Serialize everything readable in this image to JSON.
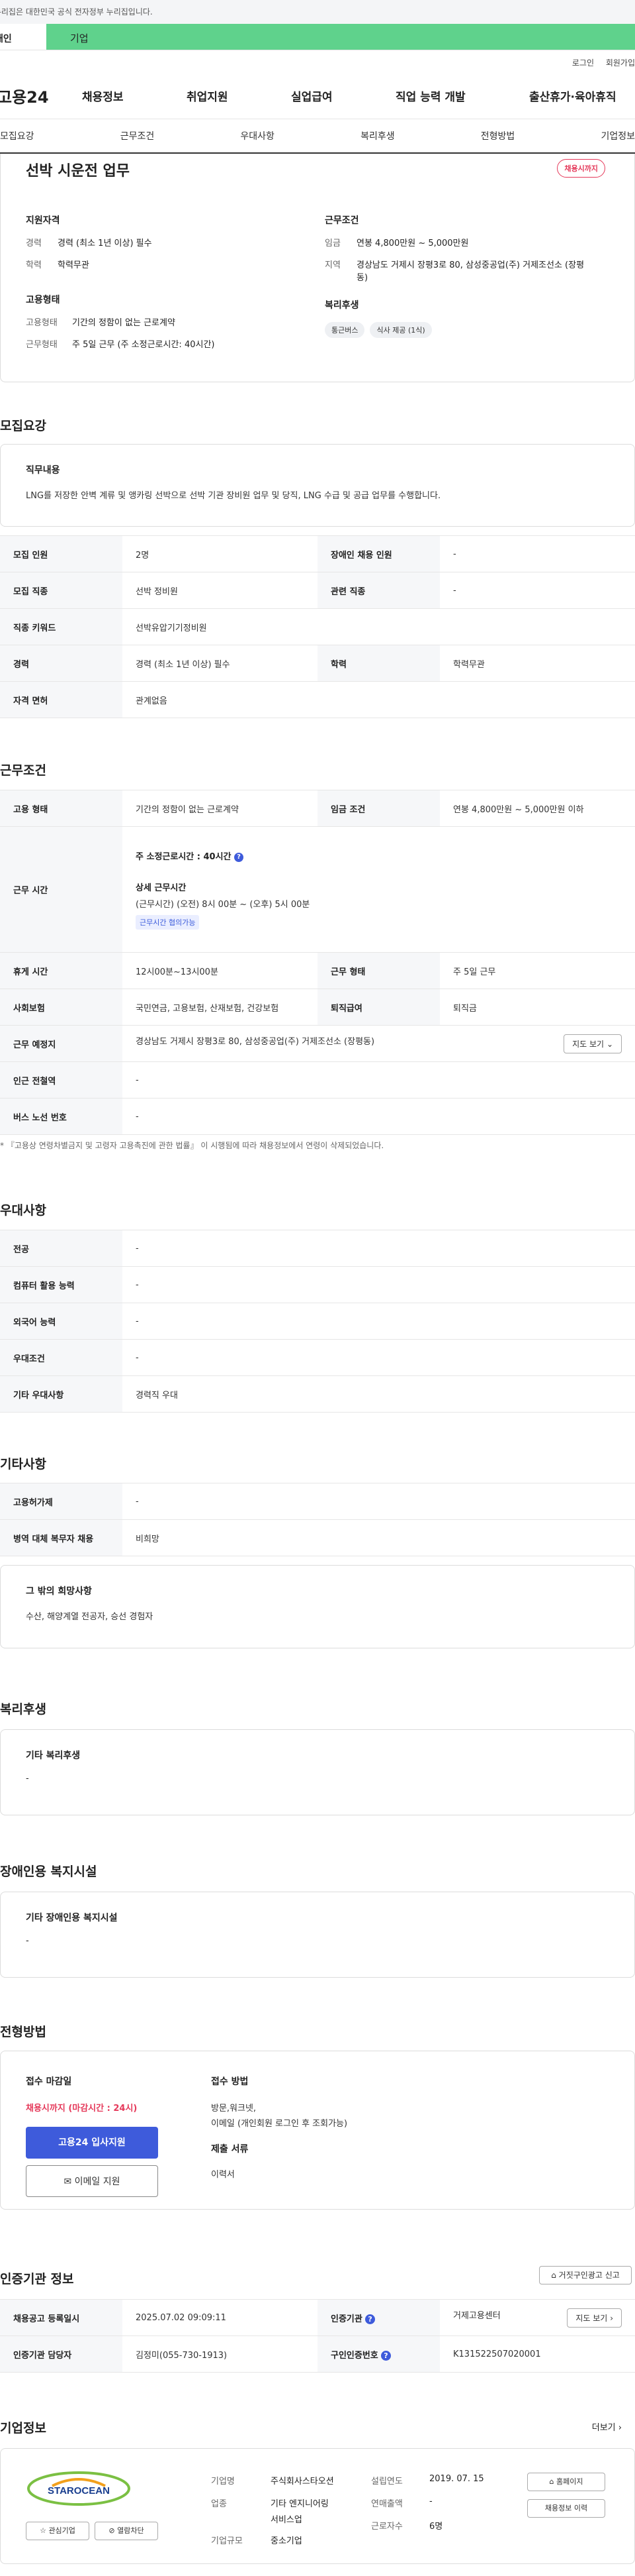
{
  "gov_banner": "이 누리집은 대한민국 공식 전자정부 누리집입니다.",
  "tabs": {
    "personal": "개인",
    "business": "기업"
  },
  "util": {
    "login": "로그인",
    "signup": "회원가입"
  },
  "gnb": {
    "logo": "고용24",
    "menus": [
      "채용정보",
      "취업지원",
      "실업급여",
      "직업 능력 개발",
      "출산휴가·육아휴직"
    ]
  },
  "subnav": [
    "모집요강",
    "근무조건",
    "우대사항",
    "복리후생",
    "전형방법",
    "기업정보"
  ],
  "summary": {
    "title": "선박 시운전 업무",
    "badge": "채용시까지",
    "qual_title": "지원자격",
    "career_k": "경력",
    "career_v": "경력 (최소 1년 이상) 필수",
    "edu_k": "학력",
    "edu_v": "학력무관",
    "emp_title": "고용형태",
    "emptype_k": "고용형태",
    "emptype_v": "기간의 정함이 없는 근로계약",
    "worktype_k": "근무형태",
    "worktype_v": "주 5일 근무 (주 소정근로시간: 40시간)",
    "cond_title": "근무조건",
    "wage_k": "임금",
    "wage_v": "연봉 4,800만원 ~ 5,000만원",
    "loc_k": "지역",
    "loc_v": "경상남도 거제시 장평3로 80, 삼성중공업(주) 거제조선소 (장평동)",
    "welfare_title": "복리후생",
    "chips": [
      "통근버스",
      "식사 제공 (1식)"
    ]
  },
  "recruit": {
    "title": "모집요강",
    "duty_title": "직무내용",
    "duty_text": "LNG를 저장한 안벽 계류 및 앵카링 선박으로 선박 기관 장비원 업무 및 당직, LNG 수급 및 공급 업무를 수행합니다.",
    "rows": [
      {
        "k1": "모집 인원",
        "v1": "2명",
        "k2": "장애인 채용 인원",
        "v2": "-"
      },
      {
        "k1": "모집 직종",
        "v1": "선박 정비원",
        "k2": "관련 직종",
        "v2": "-"
      },
      {
        "k1": "직종 키워드",
        "v1": "선박유압기기정비원"
      },
      {
        "k1": "경력",
        "v1": "경력 (최소 1년 이상) 필수",
        "k2": "학력",
        "v2": "학력무관"
      },
      {
        "k1": "자격 면허",
        "v1": "관계없음"
      }
    ]
  },
  "work": {
    "title": "근무조건",
    "emptype_k": "고용 형태",
    "emptype_v": "기간의 정함이 없는 근로계약",
    "wage_k": "임금 조건",
    "wage_v": "연봉 4,800만원 ~ 5,000만원 이하",
    "hours_k": "근무 시간",
    "hours_main": "주 소정근로시간 : 40시간",
    "hours_detail_title": "상세 근무시간",
    "hours_detail": "(근무시간) (오전) 8시 00분 ~ (오후) 5시 00분",
    "hours_badge": "근무시간 협의가능",
    "rest_k": "휴게 시간",
    "rest_v": "12시00분~13시00분",
    "form_k": "근무 형태",
    "form_v": "주 5일 근무",
    "ins_k": "사회보험",
    "ins_v": "국민연금, 고용보험, 산재보험, 건강보험",
    "ret_k": "퇴직급여",
    "ret_v": "퇴직금",
    "place_k": "근무 예정지",
    "place_v": "경상남도 거제시 장평3로 80, 삼성중공업(주) 거제조선소 (장평동)",
    "map_btn": "지도 보기",
    "sub_k": "인근 전철역",
    "sub_v": "-",
    "bus_k": "버스 노선 번호",
    "bus_v": "-",
    "note": "* 『고용상 연령차별금지 및 고령자 고용촉진에 관한 법률』 이 시행됨에 따라 채용정보에서 연령이 삭제되었습니다."
  },
  "pref": {
    "title": "우대사항",
    "rows": [
      {
        "k": "전공",
        "v": "-"
      },
      {
        "k": "컴퓨터 활용 능력",
        "v": "-"
      },
      {
        "k": "외국어 능력",
        "v": "-"
      },
      {
        "k": "우대조건",
        "v": "-"
      },
      {
        "k": "기타 우대사항",
        "v": "경력직 우대"
      }
    ]
  },
  "etc": {
    "title": "기타사항",
    "rows": [
      {
        "k": "고용허가제",
        "v": "-"
      },
      {
        "k": "병역 대체 복무자 채용",
        "v": "비희망"
      }
    ],
    "box_title": "그 밖의 희망사항",
    "box_text": "수산, 해양계열 전공자, 승선 경험자"
  },
  "welfare": {
    "title": "복리후생",
    "box_title": "기타 복리후생",
    "box_text": "-"
  },
  "disabled": {
    "title": "장애인용 복지시설",
    "box_title": "기타 장애인용 복지시설",
    "box_text": "-"
  },
  "selection": {
    "title": "전형방법",
    "deadline_title": "접수 마감일",
    "deadline": "채용시까지 (마감시간 : 24시)",
    "apply_btn": "고용24 입사지원",
    "email_btn": "이메일 지원",
    "method_title": "접수 방법",
    "method_text1": "방문,워크넷,",
    "method_text2": "이메일 (개인회원 로그인 후 조회가능)",
    "docs_title": "제출 서류",
    "docs_text": "이력서"
  },
  "cert": {
    "title": "인증기관 정보",
    "report_btn": "거짓구인광고 신고",
    "reg_k": "채용공고 등록일시",
    "reg_v": "2025.07.02 09:09:11",
    "org_k": "인증기관",
    "org_v": "거제고용센터",
    "map_btn": "지도 보기",
    "mgr_k": "인증기관 담당자",
    "mgr_v": "김정미(055-730-1913)",
    "no_k": "구인인증번호",
    "no_v": "K131522507020001"
  },
  "company": {
    "title": "기업정보",
    "more": "더보기",
    "logo_text": "STAROCEAN",
    "fav_btn": "관심기업",
    "block_btn": "열람차단",
    "name_k": "기업명",
    "name_v": "주식회사스타오션",
    "ind_k": "업종",
    "ind_v1": "기타 엔지니어링",
    "ind_v2": "서비스업",
    "size_k": "기업규모",
    "size_v": "중소기업",
    "year_k": "설립연도",
    "year_v": "2019. 07. 15",
    "sales_k": "연매출액",
    "sales_v": "-",
    "emp_k": "근로자수",
    "emp_v": "6명",
    "home_btn": "홈페이지",
    "hist_btn": "채용정보 이력"
  },
  "colors": {
    "accent": "#3e5bdb",
    "green": "#5fd28c",
    "red": "#e5395a"
  }
}
